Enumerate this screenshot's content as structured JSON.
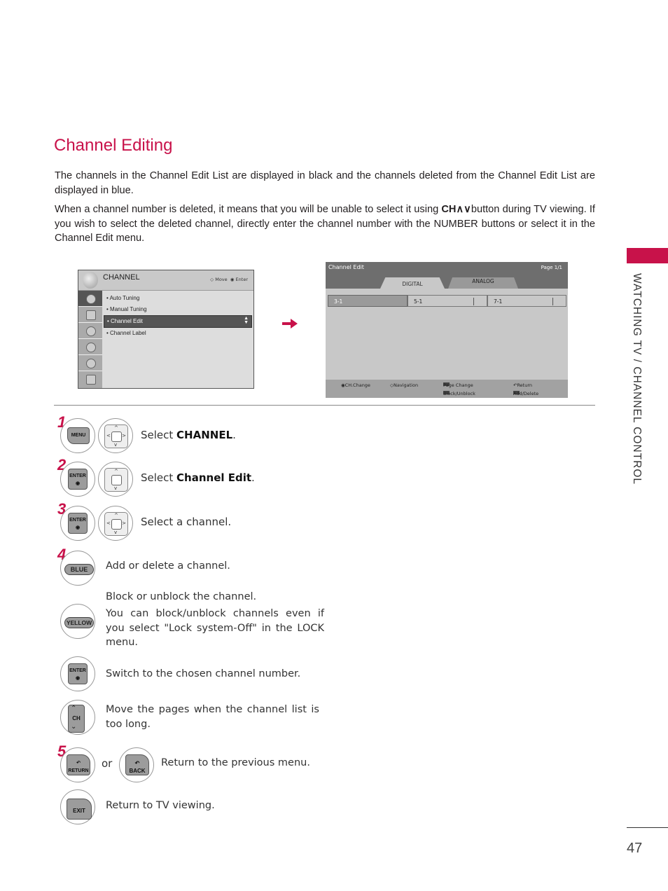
{
  "page": {
    "title": "Channel Editing",
    "paragraph1": "The channels in the Channel Edit List are displayed in black and the channels deleted from the Channel Edit List are displayed in blue.",
    "paragraph2_pre": "When a channel number is deleted, it means that you will be unable to select it using ",
    "paragraph2_bold": "CH∧∨",
    "paragraph2_post": "button during TV viewing. If you wish to select the deleted channel, directly enter the channel number with the NUMBER buttons or select it in the Channel Edit menu.",
    "side_label": "WATCHING TV / CHANNEL CONTROL",
    "page_number": "47",
    "accent_color": "#c8124a"
  },
  "menu_screen": {
    "title": "CHANNEL",
    "hint_move": "Move",
    "hint_enter": "Enter",
    "icons": [
      "channel-icon",
      "picture-icon",
      "audio-icon",
      "time-icon",
      "lock-icon",
      "option-icon"
    ],
    "items": [
      {
        "label": "Auto Tuning",
        "selected": false
      },
      {
        "label": "Manual Tuning",
        "selected": false
      },
      {
        "label": "Channel Edit",
        "selected": true
      },
      {
        "label": "Channel Label",
        "selected": false
      }
    ]
  },
  "edit_screen": {
    "title": "Channel Edit",
    "page": "Page 1/1",
    "tabs": [
      "DIGITAL",
      "ANALOG"
    ],
    "channels": [
      "3-1",
      "5-1",
      "7-1"
    ],
    "footer": {
      "ch_change": "CH.Change",
      "navigation": "Navigation",
      "page_change": "Page Change",
      "return": "Return",
      "block": "Block/Unblock",
      "add_delete": "Add/Delete"
    }
  },
  "steps": [
    {
      "number": "1",
      "keys": [
        "MENU"
      ],
      "text_pre": "Select ",
      "text_bold": "CHANNEL",
      "text_post": "."
    },
    {
      "number": "2",
      "keys": [
        "ENTER"
      ],
      "text_pre": "Select ",
      "text_bold": "Channel Edit",
      "text_post": "."
    },
    {
      "number": "3",
      "keys": [
        "ENTER"
      ],
      "text_pre": "Select a channel.",
      "text_bold": "",
      "text_post": ""
    },
    {
      "number": "4",
      "keys": [
        "BLUE"
      ],
      "text": "Add or delete a channel."
    },
    {
      "keys": [
        "YELLOW"
      ],
      "text_line1": "Block or unblock the channel.",
      "text": "You can block/unblock channels even if you select \"Lock system-Off\" in the LOCK menu."
    },
    {
      "keys": [
        "ENTER"
      ],
      "text": "Switch to the chosen channel number."
    },
    {
      "keys": [
        "CH"
      ],
      "text": "Move the pages when the channel list is too long."
    },
    {
      "number": "5",
      "keys": [
        "RETURN",
        "BACK"
      ],
      "or": "or",
      "text": "Return to the previous menu."
    },
    {
      "keys": [
        "EXIT"
      ],
      "text": "Return to TV viewing."
    }
  ]
}
